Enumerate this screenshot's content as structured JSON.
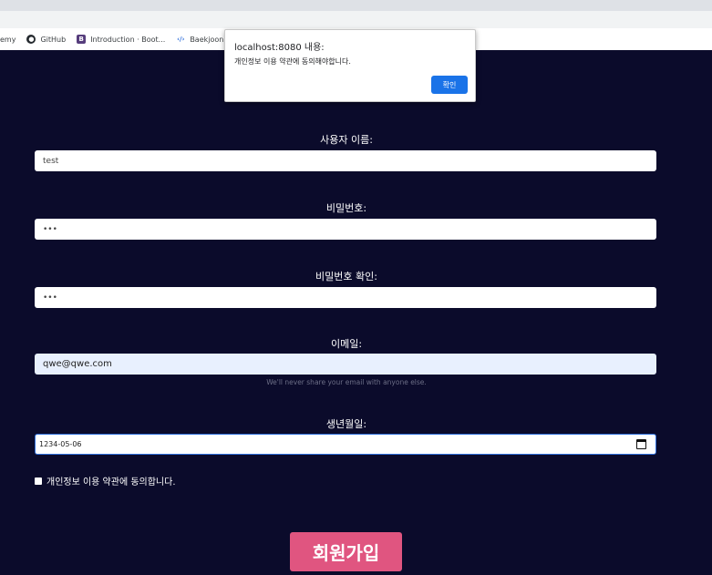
{
  "browser": {
    "bookmarks": [
      {
        "label": "emy",
        "icon": "none"
      },
      {
        "label": "GitHub",
        "icon": "github-icon"
      },
      {
        "label": "Introduction · Boot...",
        "icon": "bootstrap-icon"
      },
      {
        "label": "Baekjoon Online J...",
        "icon": "code-icon"
      }
    ]
  },
  "form": {
    "username": {
      "label": "사용자 이름:",
      "value": "test"
    },
    "password": {
      "label": "비밀번호:",
      "value": "•••"
    },
    "password_confirm": {
      "label": "비밀번호 확인:",
      "value": "•••"
    },
    "email": {
      "label": "이메일:",
      "value": "qwe@qwe.com",
      "help": "We'll never share your email with anyone else."
    },
    "birthdate": {
      "label": "생년월일:",
      "value": "1234-05-06"
    },
    "terms": {
      "label": "개인정보 이용 약관에 동의합니다.",
      "checked": false
    },
    "submit_label": "회원가입"
  },
  "alert": {
    "title": "localhost:8080 내용:",
    "message": "개인정보 이용 약관에 동의해야합니다.",
    "ok_label": "확인"
  },
  "colors": {
    "page_bg": "#0b0b2b",
    "submit_bg": "#e05580",
    "alert_button": "#1a73e8",
    "email_autofill_bg": "#e8f0fe"
  }
}
